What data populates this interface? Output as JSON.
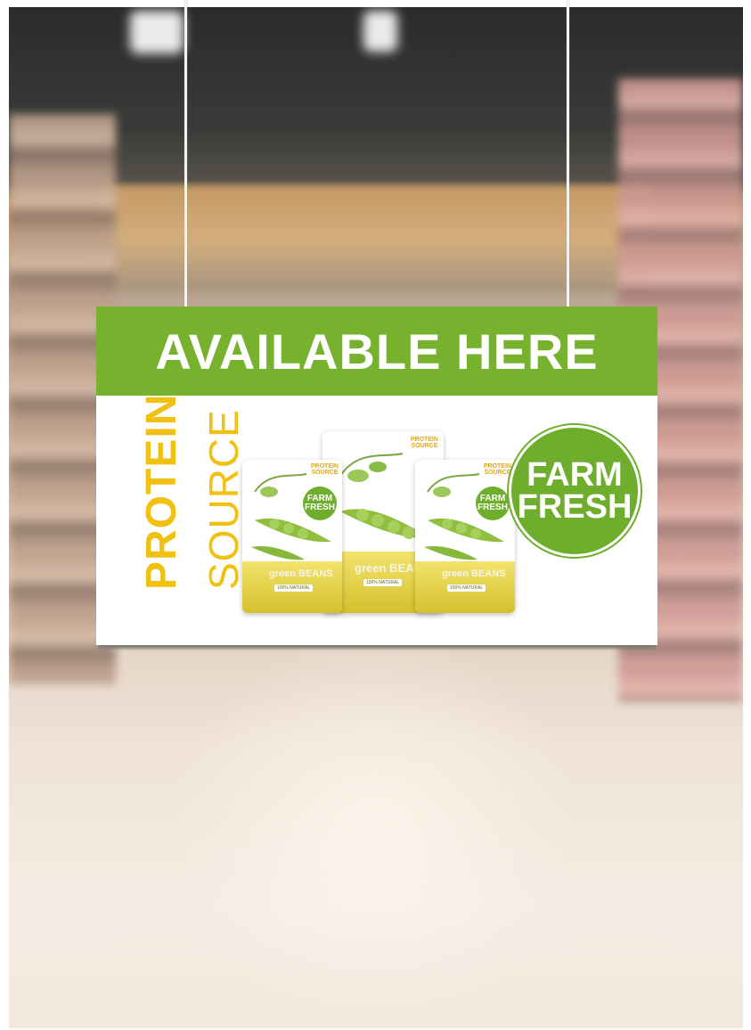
{
  "sign": {
    "headline": "AVAILABLE HERE",
    "tagline_line1": "PROTEIN",
    "tagline_line2": "SOURCE",
    "badge_line1": "FARM",
    "badge_line2": "FRESH"
  },
  "product": {
    "badge_line1": "FARM",
    "badge_line2": "FRESH",
    "name": "green BEANS",
    "claim": "100% NATURAL",
    "corner_tag_line1": "PROTEIN",
    "corner_tag_line2": "SOURCE"
  },
  "colors": {
    "sign_green": "#77b22f",
    "tagline_yellow": "#f0c012",
    "badge_green": "#6fae2d"
  }
}
